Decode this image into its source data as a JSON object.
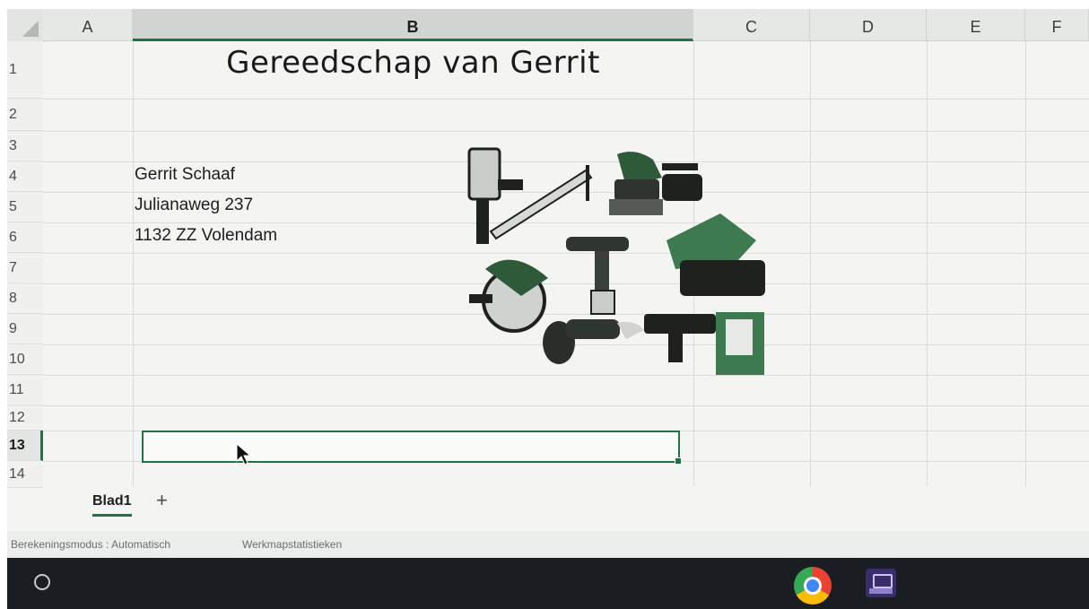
{
  "columns": [
    "A",
    "B",
    "C",
    "D",
    "E",
    "F"
  ],
  "rows": [
    "1",
    "2",
    "3",
    "4",
    "5",
    "6",
    "7",
    "8",
    "9",
    "10",
    "11",
    "12",
    "13",
    "14"
  ],
  "sheet": {
    "title": "Gereedschap van Gerrit",
    "address_name": "Gerrit Schaaf",
    "address_street": "Julianaweg 237",
    "address_city": "1132 ZZ Volendam"
  },
  "sheet_tabs": {
    "active": "Blad1",
    "add_label": "+"
  },
  "status": {
    "calc_mode": "Berekeningsmodus : Automatisch",
    "workbook_stats": "Werkmapstatistieken"
  },
  "taskbar": {
    "apps": [
      "chrome-icon",
      "screen-app-icon"
    ]
  },
  "colors": {
    "accent": "#217346"
  }
}
